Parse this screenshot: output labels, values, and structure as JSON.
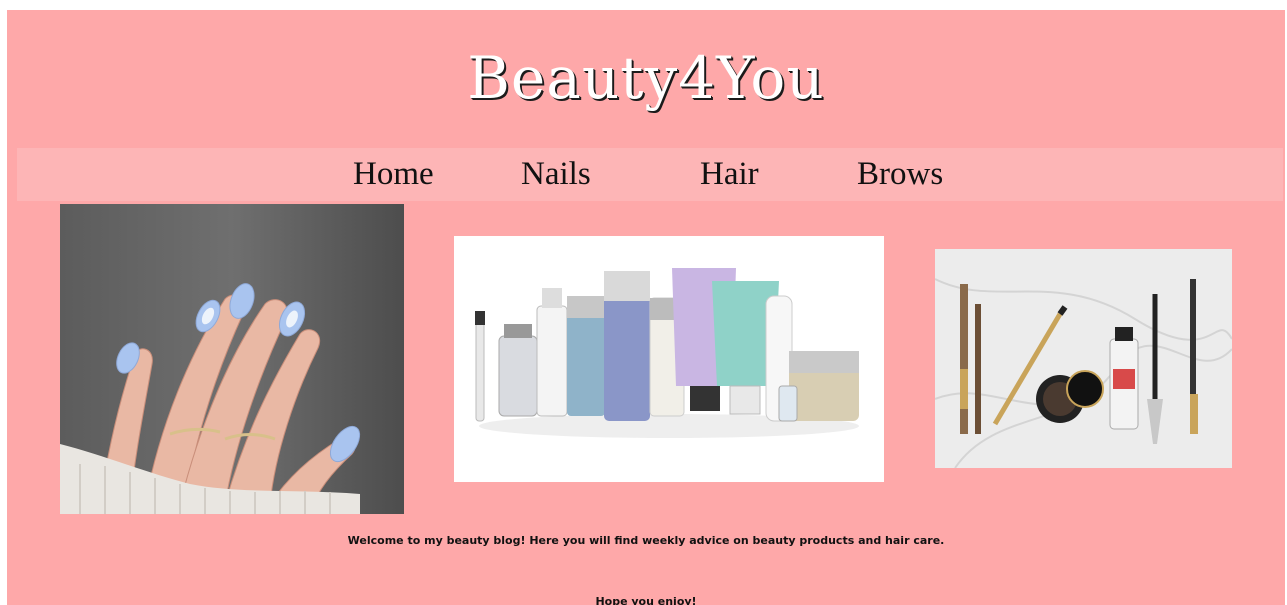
{
  "site": {
    "title": "Beauty4You",
    "background_color": "#fea8a9",
    "nav_background": "#fdb5b6"
  },
  "nav": {
    "items": [
      {
        "label": "Home"
      },
      {
        "label": "Nails"
      },
      {
        "label": "Hair"
      },
      {
        "label": "Brows"
      }
    ]
  },
  "gallery": {
    "images": [
      {
        "subject": "hand with pastel blue almond nails and rings"
      },
      {
        "subject": "hair care product bottles and tubes"
      },
      {
        "subject": "brow pencils, pomade and gel on marble"
      }
    ]
  },
  "content": {
    "welcome": "Welcome to my beauty blog! Here you will find weekly advice on beauty products and hair care.",
    "closing": "Hope you enjoy!"
  }
}
